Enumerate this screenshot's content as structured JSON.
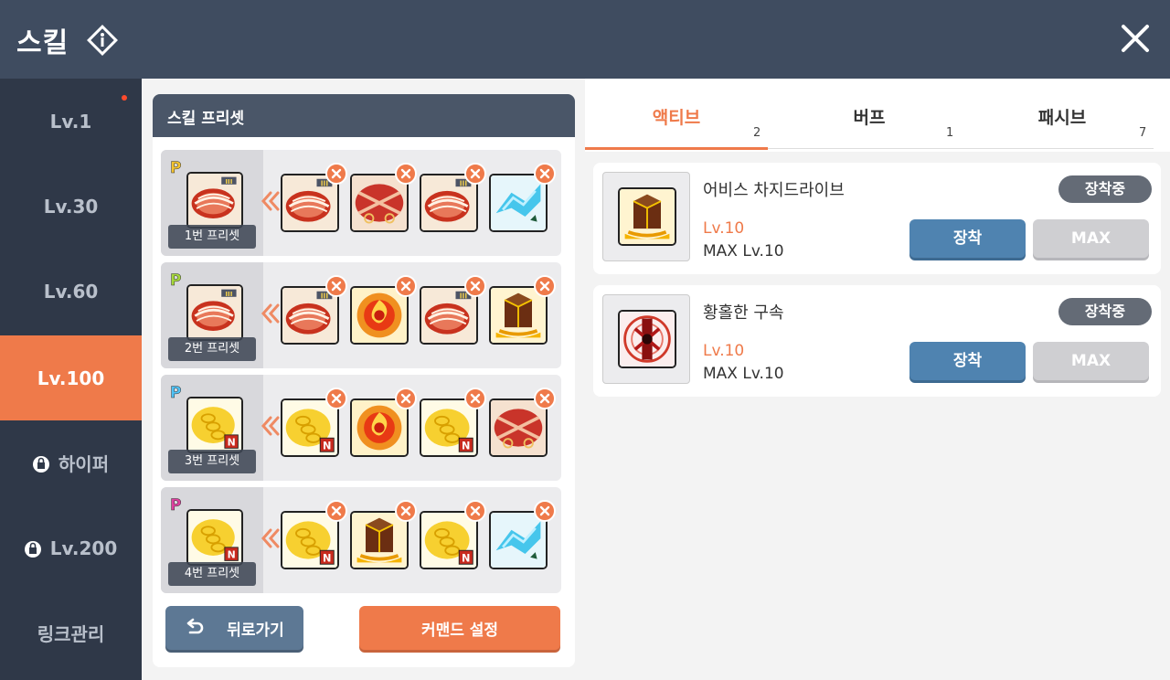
{
  "header": {
    "title": "스킬",
    "info_icon": "info-diamond-icon",
    "close_icon": "close-icon"
  },
  "sidebar": {
    "items": [
      {
        "label": "Lv.1",
        "locked": false,
        "active": false,
        "has_notification": true
      },
      {
        "label": "Lv.30",
        "locked": false,
        "active": false
      },
      {
        "label": "Lv.60",
        "locked": false,
        "active": false
      },
      {
        "label": "Lv.100",
        "locked": false,
        "active": true
      },
      {
        "label": "하이퍼",
        "locked": true,
        "active": false
      },
      {
        "label": "Lv.200",
        "locked": true,
        "active": false
      },
      {
        "label": "링크관리",
        "locked": false,
        "active": false
      }
    ]
  },
  "preset_panel": {
    "title": "스킬 프리셋",
    "presets": [
      {
        "label": "1번 프리셋",
        "badge": "P",
        "badge_color": "#f4c430"
      },
      {
        "label": "2번 프리셋",
        "badge": "P",
        "badge_color": "#a6d83a"
      },
      {
        "label": "3번 프리셋",
        "badge": "P",
        "badge_color": "#4fc3f7"
      },
      {
        "label": "4번 프리셋",
        "badge": "P",
        "badge_color": "#e040a0"
      }
    ],
    "back_button": "뒤로가기",
    "command_button": "커맨드 설정"
  },
  "tabs": [
    {
      "label": "액티브",
      "count": "2",
      "active": true
    },
    {
      "label": "버프",
      "count": "1",
      "active": false
    },
    {
      "label": "패시브",
      "count": "7",
      "active": false
    }
  ],
  "skills": [
    {
      "name": "어비스 차지드라이브",
      "level": "Lv.10",
      "max_level": "MAX Lv.10",
      "status": "장착중",
      "equip_label": "장착",
      "max_label": "MAX",
      "icon": "abyss-cube-icon"
    },
    {
      "name": "황홀한 구속",
      "level": "Lv.10",
      "max_level": "MAX Lv.10",
      "status": "장착중",
      "equip_label": "장착",
      "max_label": "MAX",
      "icon": "red-bind-icon"
    }
  ],
  "colors": {
    "accent": "#ef7a4a",
    "header_bg": "#3f4c60",
    "sidebar_bg": "#2f3848",
    "equip_blue": "#4f83b0"
  }
}
